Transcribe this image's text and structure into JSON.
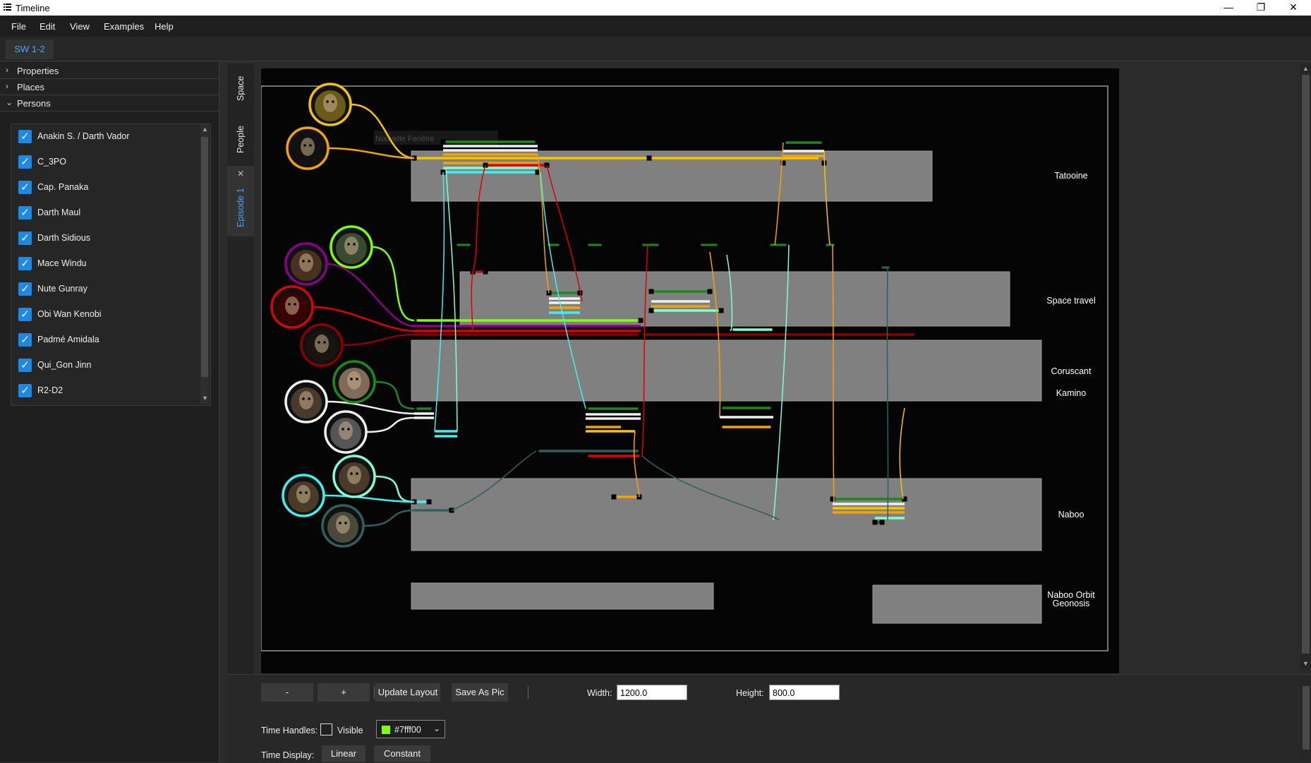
{
  "window": {
    "title": "Timeline",
    "controls": {
      "minimize": "—",
      "restore": "❐",
      "close": "✕"
    }
  },
  "menu": [
    "File",
    "Edit",
    "View",
    "Examples",
    "Help"
  ],
  "document_tab": "SW 1-2",
  "sidebar": {
    "sections": [
      {
        "label": "Properties",
        "chevron": ">"
      },
      {
        "label": "Places",
        "chevron": ">"
      },
      {
        "label": "Persons",
        "chevron": "v"
      }
    ],
    "persons": [
      {
        "name": "Anakin S. / Darth Vador",
        "checked": true
      },
      {
        "name": "C_3PO",
        "checked": true
      },
      {
        "name": "Cap. Panaka",
        "checked": true
      },
      {
        "name": "Darth Maul",
        "checked": true
      },
      {
        "name": "Darth Sidious",
        "checked": true
      },
      {
        "name": "Mace Windu",
        "checked": true
      },
      {
        "name": "Nute Gunray",
        "checked": true
      },
      {
        "name": "Obi Wan Kenobi",
        "checked": true
      },
      {
        "name": "Padmé Amidala",
        "checked": true
      },
      {
        "name": "Qui_Gon Jinn",
        "checked": true
      },
      {
        "name": "R2-D2",
        "checked": true
      }
    ]
  },
  "vertical_tabs": [
    {
      "label": "Space",
      "active": false
    },
    {
      "label": "People",
      "active": false
    },
    {
      "label": "Episode 1",
      "active": true,
      "closable": true
    }
  ],
  "timeline": {
    "ghost_tooltip": "Nouvelle Fenêtre",
    "places": [
      "Tatooine",
      "Space travel",
      "Coruscant",
      "Kamino",
      "Naboo",
      "Naboo Orbit",
      "Geonosis"
    ],
    "colors": {
      "anakin": "#f5a300",
      "c3po": "#f5c400",
      "panaka": "#ffffff",
      "maul": "#e00000",
      "sidious": "#8a0000",
      "windu": "#8a008a",
      "nute": "#2e6060",
      "obiwan": "#7fffd4",
      "padme": "#1a8a1a",
      "quigon": "#3ff0f0",
      "r2d2": "#f0f0f0",
      "yoda": "#7fff00"
    }
  },
  "toolbar": {
    "zoom_out": "-",
    "zoom_in": "+",
    "update_layout": "Update Layout",
    "save_as_pic": "Save As Pic",
    "width_label": "Width:",
    "width_value": "1200.0",
    "height_label": "Height:",
    "height_value": "800.0",
    "time_handles_label": "Time Handles:",
    "visible_label": "Visible",
    "visible_checked": false,
    "handle_color": "#7fff00",
    "time_display_label": "Time Display:",
    "linear_label": "Linear",
    "constant_label": "Constant"
  }
}
